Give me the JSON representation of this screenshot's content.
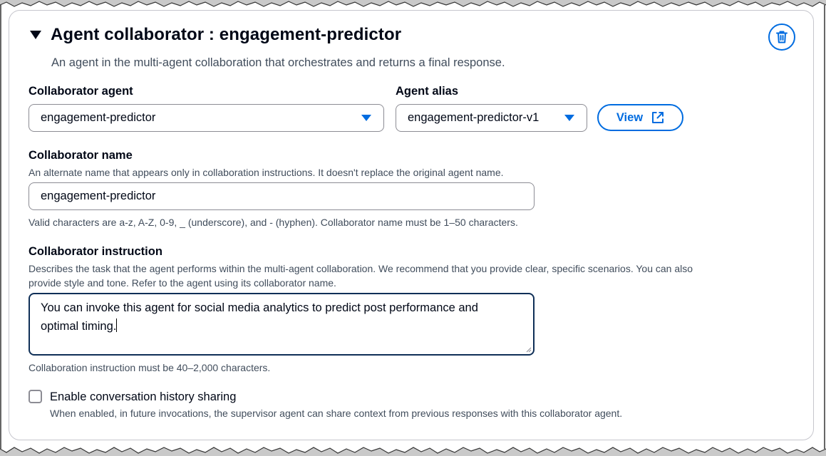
{
  "panel": {
    "title": "Agent collaborator : engagement-predictor",
    "subtitle": "An agent in the multi-agent collaboration that orchestrates and returns a final response."
  },
  "collaborator_agent": {
    "label": "Collaborator agent",
    "value": "engagement-predictor"
  },
  "agent_alias": {
    "label": "Agent alias",
    "value": "engagement-predictor-v1",
    "view_label": "View"
  },
  "collaborator_name": {
    "label": "Collaborator name",
    "description": "An alternate name that appears only in collaboration instructions. It doesn't replace the original agent name.",
    "value": "engagement-predictor",
    "constraint": "Valid characters are a-z, A-Z, 0-9, _ (underscore), and - (hyphen). Collaborator name must be 1–50 characters."
  },
  "collaborator_instruction": {
    "label": "Collaborator instruction",
    "description_line1": "Describes the task that the agent performs within the multi-agent collaboration. We recommend that you provide clear, specific scenarios. You can also",
    "description_line2": "provide style and tone. Refer to the agent using its collaborator name.",
    "value_line1": "You can invoke this agent for social media analytics to predict post performance and",
    "value_line2": "optimal timing.",
    "constraint": "Collaboration instruction must be 40–2,000 characters."
  },
  "history_sharing": {
    "label": "Enable conversation history sharing",
    "description": "When enabled, in future invocations, the supervisor agent can share context from previous responses with this collaborator agent.",
    "checked": false
  },
  "icons": {
    "collapse": "caret-down-icon",
    "delete": "trash-icon",
    "external": "external-link-icon",
    "dropdown": "triangle-down-icon"
  },
  "colors": {
    "accent": "#006ce0",
    "text": "#000716",
    "muted": "#414d5c",
    "border": "#8c8c94"
  }
}
